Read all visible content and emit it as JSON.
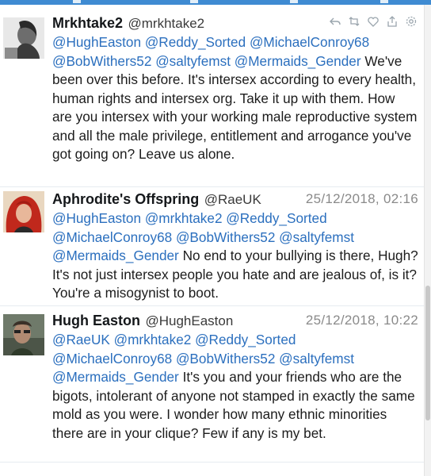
{
  "tweets": [
    {
      "name": "Mrkhtake2",
      "handle": "@mrkhtake2",
      "time": "",
      "mentions": [
        "@HughEaston",
        "@Reddy_Sorted",
        "@MichaelConroy68",
        "@BobWithers52",
        "@saltyfemst",
        "@Mermaids_Gender"
      ],
      "text": "We've been over this before. It's intersex according to every health, human rights and intersex org. Take it up with them. How are you intersex with your working male reproductive system and all the male privilege, entitlement and arrogance you've got going on? Leave us alone.",
      "actions": [
        "reply-icon",
        "retweet-icon",
        "like-icon",
        "share-icon",
        "gear-icon"
      ]
    },
    {
      "name": "Aphrodite's Offspring",
      "handle": "@RaeUK",
      "time": "25/12/2018, 02:16",
      "mentions": [
        "@HughEaston",
        "@mrkhtake2",
        "@Reddy_Sorted",
        "@MichaelConroy68",
        "@BobWithers52",
        "@saltyfemst",
        "@Mermaids_Gender"
      ],
      "text": "No end to your bullying is there, Hugh? It's not just intersex people you hate and are jealous of, is it? You're a misogynist to boot."
    },
    {
      "name": "Hugh Easton",
      "handle": "@HughEaston",
      "time": "25/12/2018, 10:22",
      "mentions": [
        "@RaeUK",
        "@mrkhtake2",
        "@Reddy_Sorted",
        "@MichaelConroy68",
        "@BobWithers52",
        "@saltyfemst",
        "@Mermaids_Gender"
      ],
      "text": "It's you and your friends who are the bigots, intolerant of anyone not stamped in exactly the same mold as you were. I wonder how many ethnic minorities there are in your clique? Few if any is my bet."
    }
  ],
  "colors": {
    "mention": "#2b6fbe",
    "topbar": "#3f8bd2",
    "time": "#8a8a8a"
  }
}
